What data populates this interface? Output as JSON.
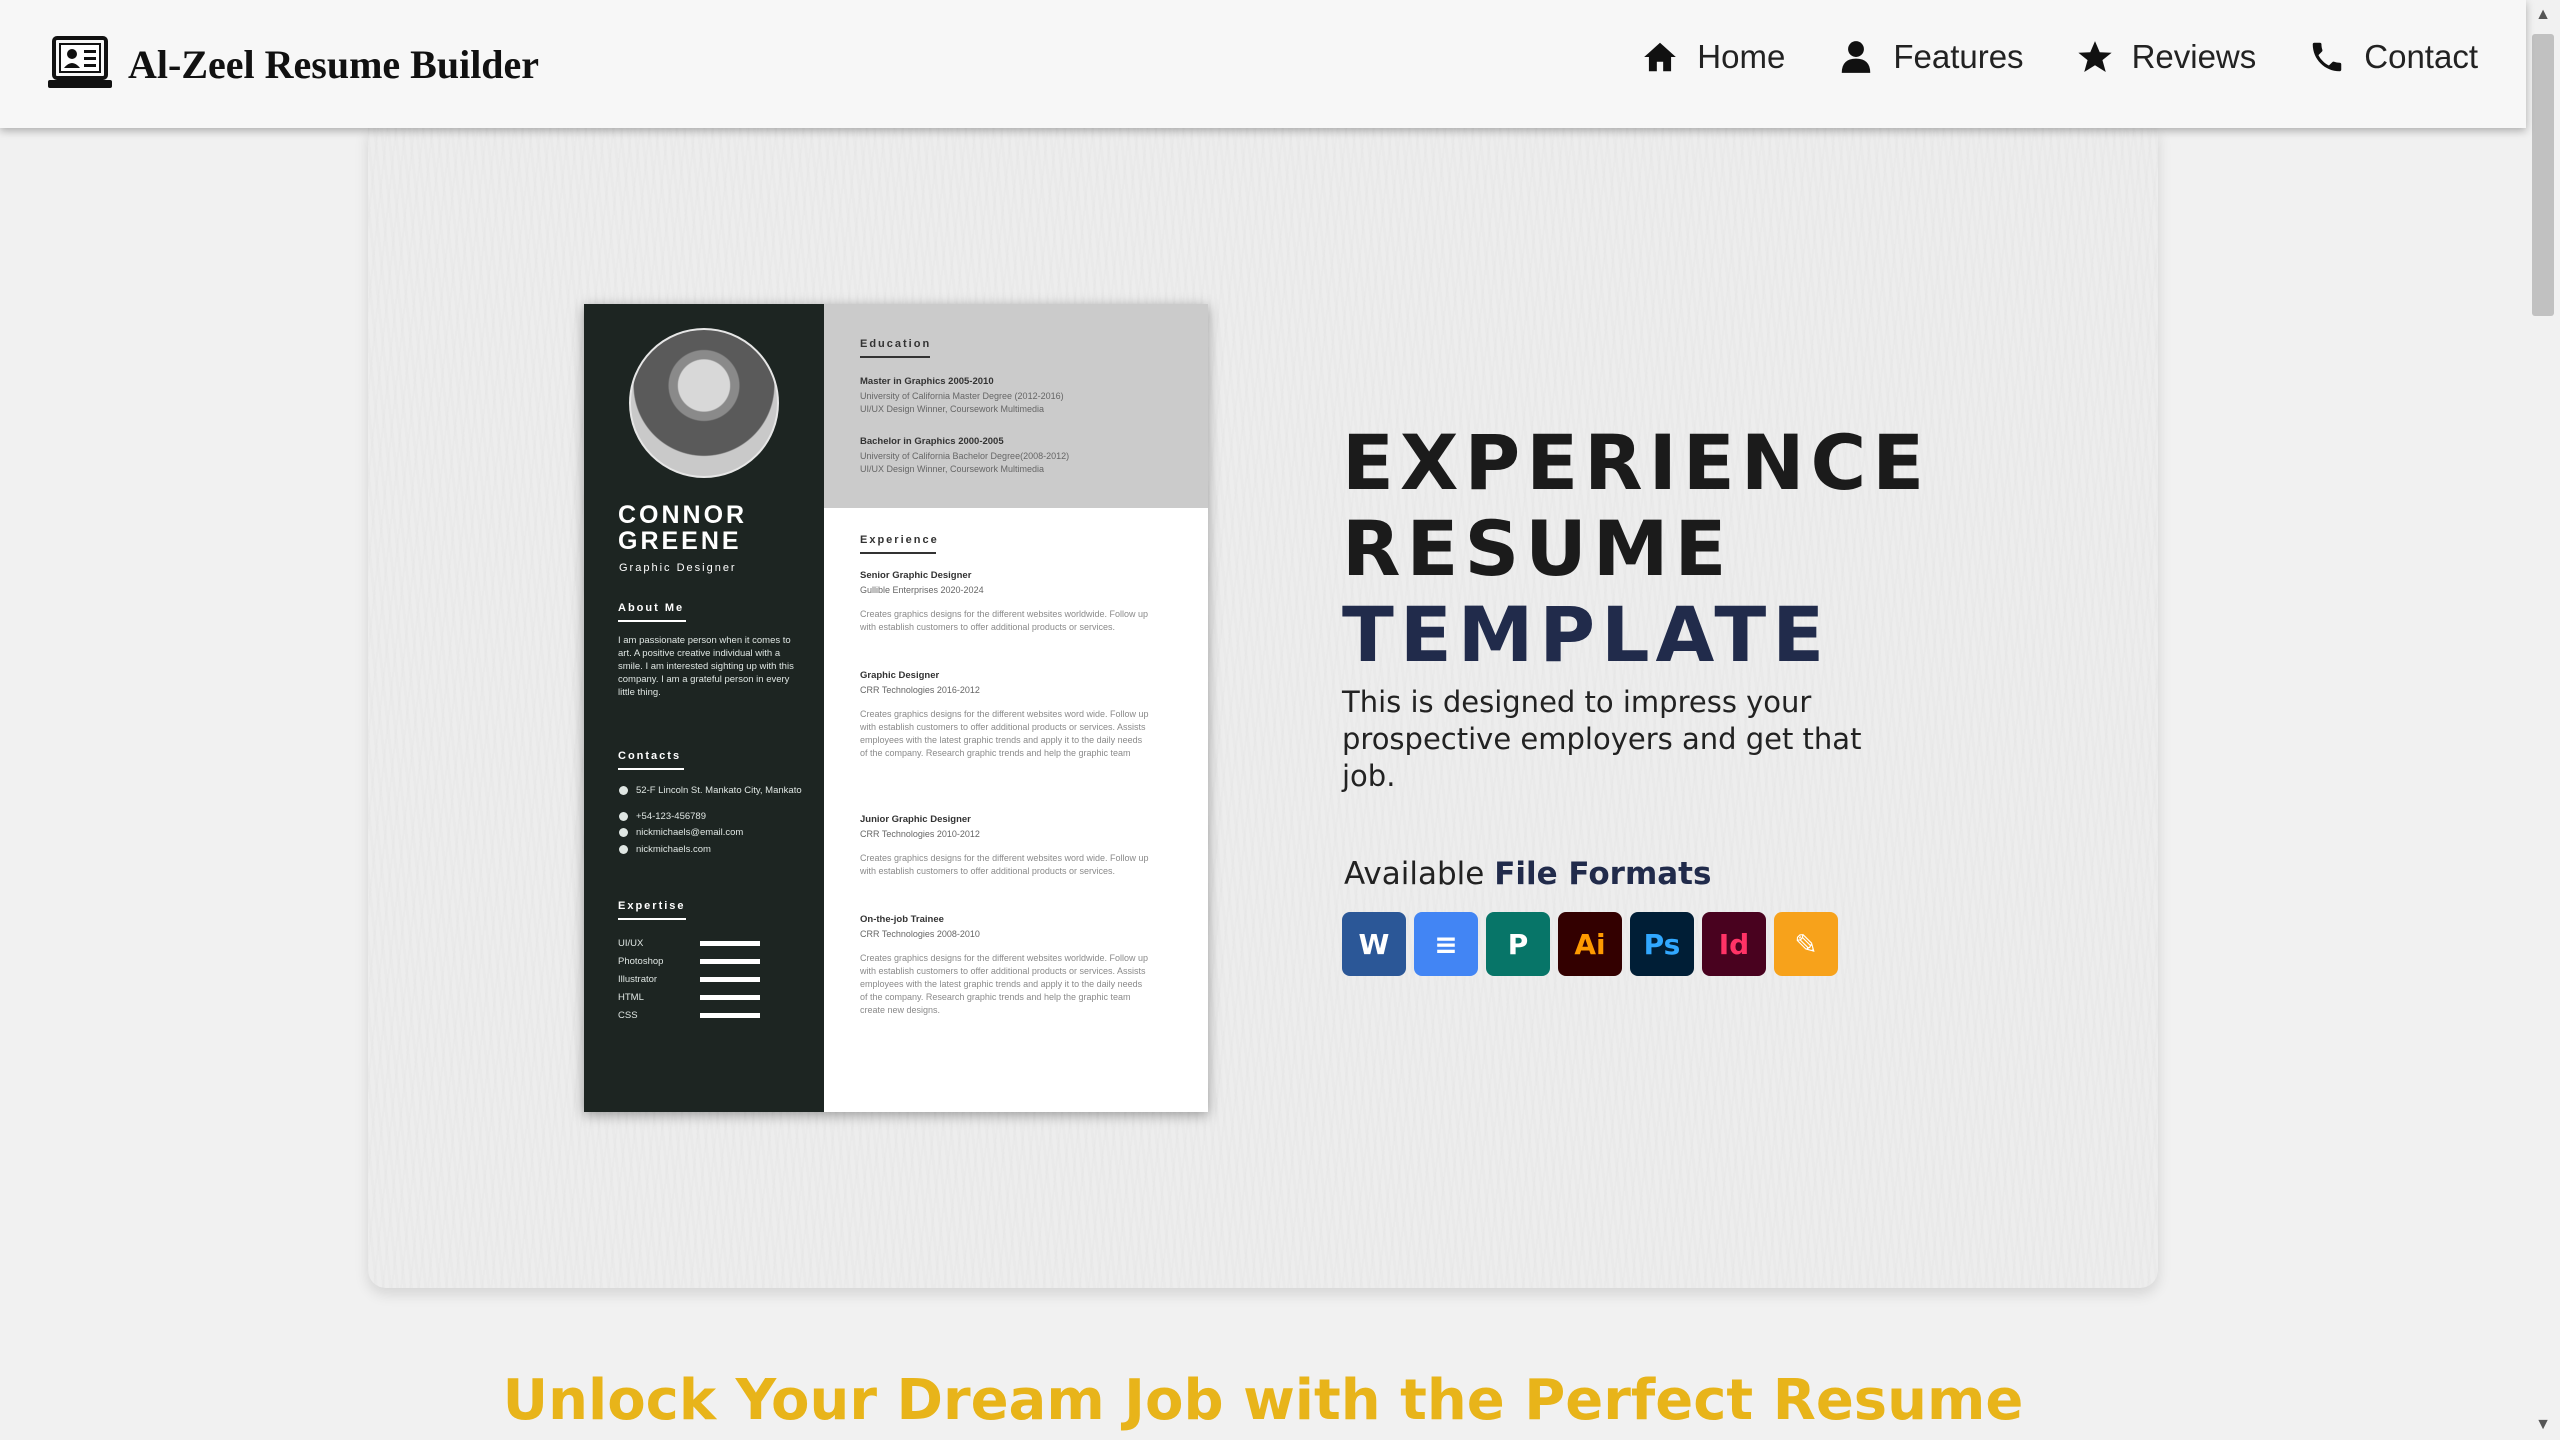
{
  "navbar": {
    "brand": "Al-Zeel Resume Builder",
    "links": [
      {
        "label": "Home",
        "icon": "home-icon"
      },
      {
        "label": "Features",
        "icon": "user-icon"
      },
      {
        "label": "Reviews",
        "icon": "star-icon"
      },
      {
        "label": "Contact",
        "icon": "phone-icon"
      }
    ]
  },
  "resume": {
    "name": "CONNOR\nGREENE",
    "role": "Graphic Designer",
    "about_title": "About Me",
    "about_text": "I am passionate person when it comes to art. A positive creative individual with a smile. I am interested sighting up with this company. I am a grateful person in every little thing.",
    "contacts_title": "Contacts",
    "contacts": [
      "52-F Lincoln St. Mankato City, Mankato",
      "+54-123-456789",
      "nickmichaels@email.com",
      "nickmichaels.com"
    ],
    "expertise_title": "Expertise",
    "skills": [
      "UI/UX",
      "Photoshop",
      "Illustrator",
      "HTML",
      "CSS"
    ],
    "education_title": "Education",
    "education": [
      {
        "title": "Master in Graphics 2005-2010",
        "line1": "University of California Master Degree (2012-2016)",
        "line2": "UI/UX Design Winner, Coursework Multimedia"
      },
      {
        "title": "Bachelor in Graphics 2000-2005",
        "line1": "University of California Bachelor Degree(2008-2012)",
        "line2": "UI/UX Design Winner, Coursework Multimedia"
      }
    ],
    "experience_title": "Experience",
    "experience": [
      {
        "title": "Senior Graphic Designer",
        "company": "Gullible Enterprises 2020-2024",
        "desc": "Creates graphics designs for the different websites worldwide. Follow up with establish customers to offer additional products or services."
      },
      {
        "title": "Graphic Designer",
        "company": "CRR Technologies 2016-2012",
        "desc": "Creates graphics designs for the different websites word wide. Follow up with establish customers to offer additional products or services. Assists employees with the latest graphic trends and apply it to the daily needs of the company. Research graphic trends and help the graphic team"
      },
      {
        "title": "Junior Graphic Designer",
        "company": "CRR Technologies 2010-2012",
        "desc": "Creates graphics designs for the different websites word wide. Follow up with establish customers to offer additional products or services."
      },
      {
        "title": "On-the-job Trainee",
        "company": "CRR Technologies 2008-2010",
        "desc": "Creates graphics designs for the different websites worldwide. Follow up with establish customers to offer additional products or services. Assists employees with the latest graphic trends and apply it to the daily needs of the company. Research graphic trends and help the graphic team create new designs."
      }
    ]
  },
  "hero": {
    "title_line1": "EXPERIENCE",
    "title_line2": "RESUME",
    "title_line3": "TEMPLATE",
    "subtitle": "This is designed to impress your prospective employers and get that job.",
    "formats_prefix": "Available",
    "formats_strong": "File Formats",
    "formats": [
      {
        "icon": "word-icon",
        "glyph": "W",
        "color": "#2b5797"
      },
      {
        "icon": "google-docs-icon",
        "glyph": "≡",
        "color": "#4285f4"
      },
      {
        "icon": "publisher-icon",
        "glyph": "P",
        "color": "#077568"
      },
      {
        "icon": "illustrator-icon",
        "glyph": "Ai",
        "color": "#330000"
      },
      {
        "icon": "photoshop-icon",
        "glyph": "Ps",
        "color": "#001e36"
      },
      {
        "icon": "indesign-icon",
        "glyph": "Id",
        "color": "#49021f"
      },
      {
        "icon": "pages-icon",
        "glyph": "✎",
        "color": "#f7a21b"
      }
    ]
  },
  "section": {
    "heading": "Unlock Your Dream Job with the Perfect Resume"
  },
  "colors": {
    "accent_navy": "#212b4b",
    "heading_gold": "#e8b41a",
    "sidebar_dark": "#1d2522"
  }
}
